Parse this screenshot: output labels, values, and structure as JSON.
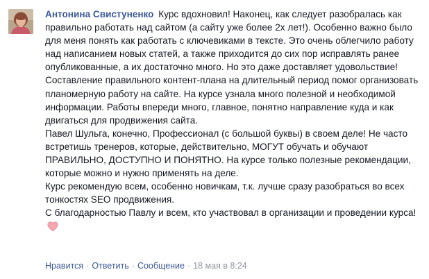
{
  "comment": {
    "author": "Антонина Свистуненко",
    "paragraphs": [
      "Курс вдохновил! Наконец, как следует разобралась как правильно работать над сайтом (а сайту уже более 2х лет!). Особенно важно было для меня понять как работать с ключевиками в тексте. Это очень облегчило работу над написанием новых статей, а также приходится до сих пор исправлять ранее опубликованные, а их достаточно много. Но это даже доставляет удовольствие!",
      "Составление правильного контент-плана на длительный период помог организовать планомерную работу на сайте. На курсе узнала много полезной и необходимой информации. Работы впереди много, главное, понятно направление куда и как двигаться для продвижения сайта.",
      "Павел Шульга, конечно, Профессионал (с большой буквы) в своем деле! Не часто встретишь тренеров, которые, действительно, МОГУТ обучать и обучают ПРАВИЛЬНО, ДОСТУПНО И ПОНЯТНО. На курсе только полезные рекомендации, которые можно и нужно применять на деле.",
      "Курс рекомендую всем, особенно новичкам, т.к. лучше сразу разобраться во всех тонкостях SEO продвижения.",
      "С благодарностью Павлу и всем, кто участвовал в организации и проведении курса!"
    ],
    "heart_icon": "heart-emoji-icon",
    "heart_color": "#f4a6b1"
  },
  "actions": {
    "like": "Нравится",
    "reply": "Ответить",
    "message": "Сообщение",
    "separator": "·",
    "timestamp": "18 мая в 8:24"
  },
  "colors": {
    "author": "#3b5998",
    "text": "#141823",
    "meta": "#90949c",
    "link": "#3b5998"
  }
}
